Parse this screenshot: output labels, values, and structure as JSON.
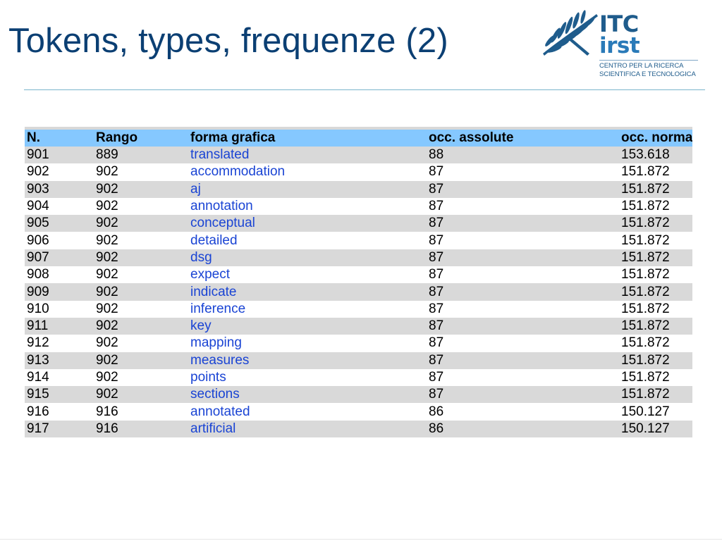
{
  "slide": {
    "title": "Tokens, types, frequenze (2)"
  },
  "logo": {
    "line1": "ITC",
    "line2": "irst",
    "sub1": "CENTRO PER LA RICERCA",
    "sub2": "SCIENTIFICA E TECNOLOGICA",
    "icon": "olive-branch-icon"
  },
  "colors": {
    "title": "#0b3f73",
    "header_bg": "#85c8ff",
    "row_alt_bg": "#d9d9d9",
    "link_text": "#1a44d4"
  },
  "table": {
    "headers": [
      "N.",
      "Rango",
      "forma grafica",
      "occ. assolute",
      "occ. normalizzate"
    ],
    "rows": [
      [
        "901",
        "889",
        "translated",
        "88",
        "153.618"
      ],
      [
        "902",
        "902",
        "accommodation",
        "87",
        "151.872"
      ],
      [
        "903",
        "902",
        "aj",
        "87",
        "151.872"
      ],
      [
        "904",
        "902",
        "annotation",
        "87",
        "151.872"
      ],
      [
        "905",
        "902",
        "conceptual",
        "87",
        "151.872"
      ],
      [
        "906",
        "902",
        "detailed",
        "87",
        "151.872"
      ],
      [
        "907",
        "902",
        "dsg",
        "87",
        "151.872"
      ],
      [
        "908",
        "902",
        "expect",
        "87",
        "151.872"
      ],
      [
        "909",
        "902",
        "indicate",
        "87",
        "151.872"
      ],
      [
        "910",
        "902",
        "inference",
        "87",
        "151.872"
      ],
      [
        "911",
        "902",
        "key",
        "87",
        "151.872"
      ],
      [
        "912",
        "902",
        "mapping",
        "87",
        "151.872"
      ],
      [
        "913",
        "902",
        "measures",
        "87",
        "151.872"
      ],
      [
        "914",
        "902",
        "points",
        "87",
        "151.872"
      ],
      [
        "915",
        "902",
        "sections",
        "87",
        "151.872"
      ],
      [
        "916",
        "916",
        "annotated",
        "86",
        "150.127"
      ],
      [
        "917",
        "916",
        "artificial",
        "86",
        "150.127"
      ]
    ]
  }
}
